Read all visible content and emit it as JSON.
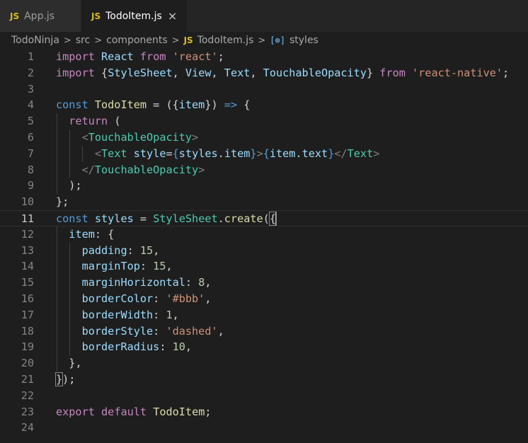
{
  "tabs": [
    {
      "icon": "JS",
      "label": "App.js",
      "active": false
    },
    {
      "icon": "JS",
      "label": "TodoItem.js",
      "active": true,
      "close": "×"
    }
  ],
  "breadcrumb": {
    "items": [
      "TodoNinja",
      "src",
      "components"
    ],
    "file_icon": "JS",
    "file": "TodoItem.js",
    "symbol_icon": "[⊚]",
    "symbol": "styles",
    "separator": ">"
  },
  "lines": [
    {
      "n": "1"
    },
    {
      "n": "2"
    },
    {
      "n": "3"
    },
    {
      "n": "4"
    },
    {
      "n": "5"
    },
    {
      "n": "6"
    },
    {
      "n": "7"
    },
    {
      "n": "8"
    },
    {
      "n": "9"
    },
    {
      "n": "10"
    },
    {
      "n": "11"
    },
    {
      "n": "12"
    },
    {
      "n": "13"
    },
    {
      "n": "14"
    },
    {
      "n": "15"
    },
    {
      "n": "16"
    },
    {
      "n": "17"
    },
    {
      "n": "18"
    },
    {
      "n": "19"
    },
    {
      "n": "20"
    },
    {
      "n": "21"
    },
    {
      "n": "22"
    },
    {
      "n": "23"
    },
    {
      "n": "24"
    }
  ],
  "code": {
    "l1": {
      "kw": "import",
      "id": "React",
      "from": "from",
      "str": "'react'",
      "end": ";"
    },
    "l2": {
      "kw": "import",
      "open": "{",
      "a": "StyleSheet",
      "b": "View",
      "c": "Text",
      "d": "TouchableOpacity",
      "close": "}",
      "from": "from",
      "str": "'react-native'",
      "end": ";"
    },
    "l4": {
      "kw": "const",
      "name": "TodoItem",
      "eq": " = ({",
      "param": "item",
      "rest": "}) ",
      "arrow": "=>",
      "brace": " {"
    },
    "l5": {
      "kw": "return",
      "rest": " ("
    },
    "l6": {
      "lt": "<",
      "tag": "TouchableOpacity",
      "gt": ">"
    },
    "l7": {
      "lt": "<",
      "tag": "Text",
      "attr": "style",
      "eq": "=",
      "ob": "{",
      "obj": "styles",
      "dot": ".",
      "prop": "item",
      "cb": "}",
      "gt": ">",
      "ob2": "{",
      "obj2": "item",
      "dot2": ".",
      "prop2": "text",
      "cb2": "}",
      "lt2": "</",
      "tag2": "Text",
      "gt2": ">"
    },
    "l8": {
      "lt": "</",
      "tag": "TouchableOpacity",
      "gt": ">"
    },
    "l9": {
      "text": ");"
    },
    "l10": {
      "text": "};"
    },
    "l11": {
      "kw": "const",
      "name": "styles",
      "eq": " = ",
      "cls": "StyleSheet",
      "dot": ".",
      "fn": "create",
      "open": "(",
      "brace": "{"
    },
    "l12": {
      "key": "item",
      "rest": ": {"
    },
    "l13": {
      "key": "padding",
      "sep": ": ",
      "val": "15",
      "end": ","
    },
    "l14": {
      "key": "marginTop",
      "sep": ": ",
      "val": "15",
      "end": ","
    },
    "l15": {
      "key": "marginHorizontal",
      "sep": ": ",
      "val": "8",
      "end": ","
    },
    "l16": {
      "key": "borderColor",
      "sep": ": ",
      "val": "'#bbb'",
      "end": ","
    },
    "l17": {
      "key": "borderWidth",
      "sep": ": ",
      "val": "1",
      "end": ","
    },
    "l18": {
      "key": "borderStyle",
      "sep": ": ",
      "val": "'dashed'",
      "end": ","
    },
    "l19": {
      "key": "borderRadius",
      "sep": ": ",
      "val": "10",
      "end": ","
    },
    "l20": {
      "text": "},"
    },
    "l21": {
      "brace": "}",
      "rest": ");"
    },
    "l23": {
      "kw": "export",
      "kw2": "default",
      "name": "TodoItem",
      "end": ";"
    }
  }
}
